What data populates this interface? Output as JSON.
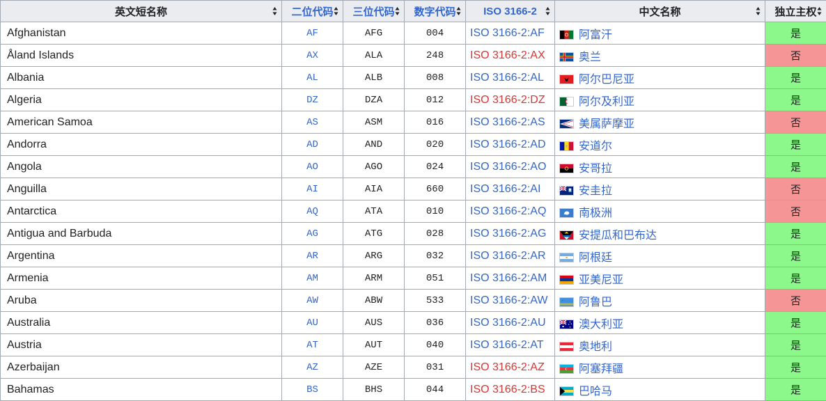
{
  "headers": {
    "english": "英文短名称",
    "alpha2": "二位代码",
    "alpha3": "三位代码",
    "numeric": "数字代码",
    "iso": "ISO 3166-2",
    "chinese": "中文名称",
    "independent": "独立主权"
  },
  "rows": [
    {
      "en": "Afghanistan",
      "a2": "AF",
      "a3": "AFG",
      "num": "004",
      "iso": "ISO 3166-2:AF",
      "iso_missing": false,
      "zh": "阿富汗",
      "ind": "是",
      "ind_yes": true,
      "flag": "afghanistan-flag-icon"
    },
    {
      "en": "Åland Islands",
      "a2": "AX",
      "a3": "ALA",
      "num": "248",
      "iso": "ISO 3166-2:AX",
      "iso_missing": true,
      "zh": "奥兰",
      "ind": "否",
      "ind_yes": false,
      "flag": "aland-flag-icon"
    },
    {
      "en": "Albania",
      "a2": "AL",
      "a3": "ALB",
      "num": "008",
      "iso": "ISO 3166-2:AL",
      "iso_missing": false,
      "zh": "阿尔巴尼亚",
      "ind": "是",
      "ind_yes": true,
      "flag": "albania-flag-icon"
    },
    {
      "en": "Algeria",
      "a2": "DZ",
      "a3": "DZA",
      "num": "012",
      "iso": "ISO 3166-2:DZ",
      "iso_missing": true,
      "zh": "阿尔及利亚",
      "ind": "是",
      "ind_yes": true,
      "flag": "algeria-flag-icon"
    },
    {
      "en": "American Samoa",
      "a2": "AS",
      "a3": "ASM",
      "num": "016",
      "iso": "ISO 3166-2:AS",
      "iso_missing": false,
      "zh": "美属萨摩亚",
      "ind": "否",
      "ind_yes": false,
      "flag": "american-samoa-flag-icon"
    },
    {
      "en": "Andorra",
      "a2": "AD",
      "a3": "AND",
      "num": "020",
      "iso": "ISO 3166-2:AD",
      "iso_missing": false,
      "zh": "安道尔",
      "ind": "是",
      "ind_yes": true,
      "flag": "andorra-flag-icon"
    },
    {
      "en": "Angola",
      "a2": "AO",
      "a3": "AGO",
      "num": "024",
      "iso": "ISO 3166-2:AO",
      "iso_missing": false,
      "zh": "安哥拉",
      "ind": "是",
      "ind_yes": true,
      "flag": "angola-flag-icon"
    },
    {
      "en": "Anguilla",
      "a2": "AI",
      "a3": "AIA",
      "num": "660",
      "iso": "ISO 3166-2:AI",
      "iso_missing": false,
      "zh": "安圭拉",
      "ind": "否",
      "ind_yes": false,
      "flag": "anguilla-flag-icon"
    },
    {
      "en": "Antarctica",
      "a2": "AQ",
      "a3": "ATA",
      "num": "010",
      "iso": "ISO 3166-2:AQ",
      "iso_missing": false,
      "zh": "南极洲",
      "ind": "否",
      "ind_yes": false,
      "flag": "antarctica-flag-icon"
    },
    {
      "en": "Antigua and Barbuda",
      "a2": "AG",
      "a3": "ATG",
      "num": "028",
      "iso": "ISO 3166-2:AG",
      "iso_missing": false,
      "zh": "安提瓜和巴布达",
      "ind": "是",
      "ind_yes": true,
      "flag": "antigua-flag-icon"
    },
    {
      "en": "Argentina",
      "a2": "AR",
      "a3": "ARG",
      "num": "032",
      "iso": "ISO 3166-2:AR",
      "iso_missing": false,
      "zh": "阿根廷",
      "ind": "是",
      "ind_yes": true,
      "flag": "argentina-flag-icon"
    },
    {
      "en": "Armenia",
      "a2": "AM",
      "a3": "ARM",
      "num": "051",
      "iso": "ISO 3166-2:AM",
      "iso_missing": false,
      "zh": "亚美尼亚",
      "ind": "是",
      "ind_yes": true,
      "flag": "armenia-flag-icon"
    },
    {
      "en": "Aruba",
      "a2": "AW",
      "a3": "ABW",
      "num": "533",
      "iso": "ISO 3166-2:AW",
      "iso_missing": false,
      "zh": "阿鲁巴",
      "ind": "否",
      "ind_yes": false,
      "flag": "aruba-flag-icon"
    },
    {
      "en": "Australia",
      "a2": "AU",
      "a3": "AUS",
      "num": "036",
      "iso": "ISO 3166-2:AU",
      "iso_missing": false,
      "zh": "澳大利亚",
      "ind": "是",
      "ind_yes": true,
      "flag": "australia-flag-icon"
    },
    {
      "en": "Austria",
      "a2": "AT",
      "a3": "AUT",
      "num": "040",
      "iso": "ISO 3166-2:AT",
      "iso_missing": false,
      "zh": "奥地利",
      "ind": "是",
      "ind_yes": true,
      "flag": "austria-flag-icon"
    },
    {
      "en": "Azerbaijan",
      "a2": "AZ",
      "a3": "AZE",
      "num": "031",
      "iso": "ISO 3166-2:AZ",
      "iso_missing": true,
      "zh": "阿塞拜疆",
      "ind": "是",
      "ind_yes": true,
      "flag": "azerbaijan-flag-icon"
    },
    {
      "en": "Bahamas",
      "a2": "BS",
      "a3": "BHS",
      "num": "044",
      "iso": "ISO 3166-2:BS",
      "iso_missing": true,
      "zh": "巴哈马",
      "ind": "是",
      "ind_yes": true,
      "flag": "bahamas-flag-icon"
    }
  ],
  "colors": {
    "independent_yes": "#8cf88c",
    "independent_no": "#f69595",
    "link": "#3366cc",
    "missing_link": "#d33333"
  }
}
